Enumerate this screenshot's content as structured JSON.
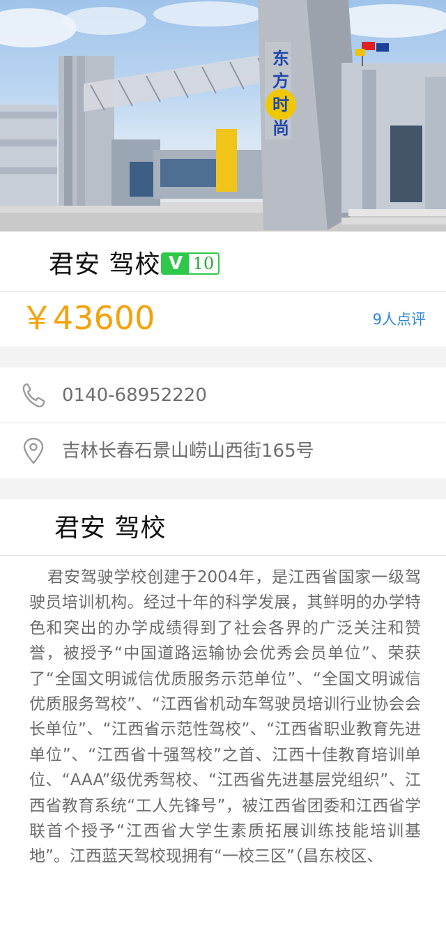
{
  "hero": {
    "sign_text": "东方时尚",
    "image_alt": "driving school gate"
  },
  "school": {
    "name": "君安 驾校",
    "vip_letter": "V",
    "vip_level": "10",
    "price": "￥43600",
    "review_count": "9人点评"
  },
  "contact": {
    "phone_icon": "phone-icon",
    "phone": "0140-68952220",
    "address_icon": "map-pin-icon",
    "address": "吉林长春石景山崂山西街165号"
  },
  "intro": {
    "title": "君安 驾校",
    "body": "君安驾驶学校创建于2004年，是江西省国家一级驾驶员培训机构。经过十年的科学发展，其鲜明的办学特色和突出的办学成绩得到了社会各界的广泛关注和赞誉，被授予“中国道路运输协会优秀会员单位”、荣获了“全国文明诚信优质服务示范单位”、“全国文明诚信优质服务驾校”、“江西省机动车驾驶员培训行业协会会长单位”、“江西省示范性驾校”、“江西省职业教育先进单位”、“江西省十强驾校”之首、江西十佳教育培训单位、“AAA”级优秀驾校、“江西省先进基层党组织”、江西省教育系统“工人先锋号”，被江西省团委和江西省学联首个授予“江西省大学生素质拓展训练技能培训基地”。江西蓝天驾校现拥有“一校三区”（昌东校区、"
  },
  "colors": {
    "price": "#f5a20a",
    "link": "#2b86d6",
    "badge_green": "#2fc94a",
    "background": "#f3f3f3"
  }
}
